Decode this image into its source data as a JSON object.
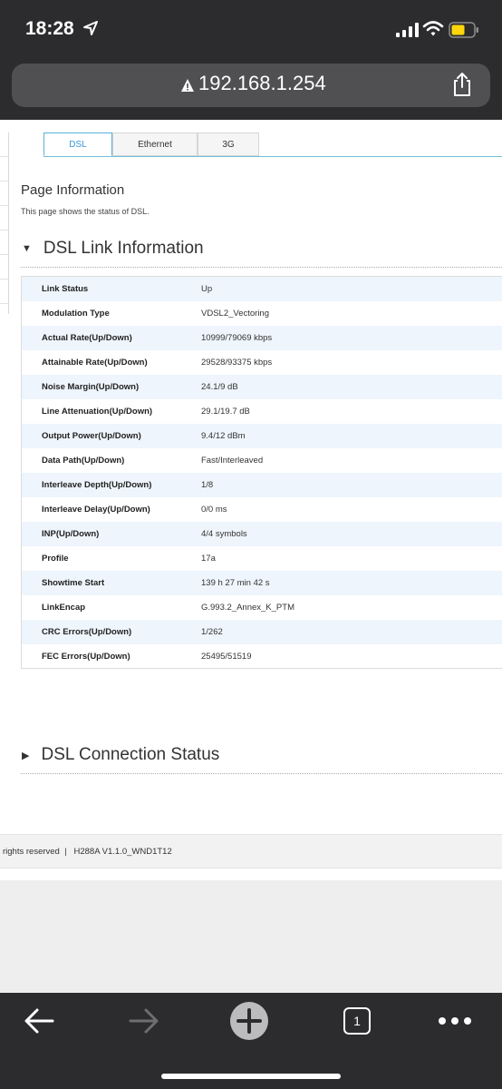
{
  "status_bar": {
    "time": "18:28"
  },
  "browser": {
    "url": "192.168.1.254",
    "tab_count": "1"
  },
  "tabs": [
    {
      "label": "DSL"
    },
    {
      "label": "Ethernet"
    },
    {
      "label": "3G"
    }
  ],
  "page": {
    "title": "Page Information",
    "description": "This page shows the status of DSL."
  },
  "link_section": {
    "title": "DSL Link Information",
    "rows": [
      {
        "label": "Link Status",
        "value": "Up"
      },
      {
        "label": "Modulation Type",
        "value": "VDSL2_Vectoring"
      },
      {
        "label": "Actual Rate(Up/Down)",
        "value": "10999/79069 kbps"
      },
      {
        "label": "Attainable Rate(Up/Down)",
        "value": "29528/93375 kbps"
      },
      {
        "label": "Noise Margin(Up/Down)",
        "value": "24.1/9 dB"
      },
      {
        "label": "Line Attenuation(Up/Down)",
        "value": "29.1/19.7 dB"
      },
      {
        "label": "Output Power(Up/Down)",
        "value": "9.4/12 dBm"
      },
      {
        "label": "Data Path(Up/Down)",
        "value": "Fast/Interleaved"
      },
      {
        "label": "Interleave Depth(Up/Down)",
        "value": "1/8"
      },
      {
        "label": "Interleave Delay(Up/Down)",
        "value": "0/0 ms"
      },
      {
        "label": "INP(Up/Down)",
        "value": "4/4 symbols"
      },
      {
        "label": "Profile",
        "value": "17a"
      },
      {
        "label": "Showtime Start",
        "value": "139 h 27 min 42 s"
      },
      {
        "label": "LinkEncap",
        "value": "G.993.2_Annex_K_PTM"
      },
      {
        "label": "CRC Errors(Up/Down)",
        "value": "1/262"
      },
      {
        "label": "FEC Errors(Up/Down)",
        "value": "25495/51519"
      }
    ]
  },
  "connection_section": {
    "title": "DSL Connection Status"
  },
  "footer": {
    "text": "rights reserved  |   H288A V1.1.0_WND1T12"
  },
  "colors": {
    "chrome": "#2c2c2e",
    "accent": "#3a9ad9",
    "row_alt": "#eef5fc",
    "battery": "#ffd60a"
  }
}
